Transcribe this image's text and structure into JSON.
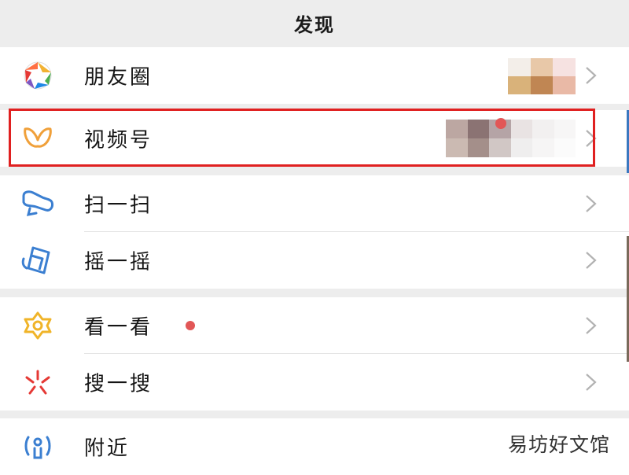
{
  "nav": {
    "title": "发现"
  },
  "menu": {
    "moments": {
      "label": "朋友圈",
      "icon": "moments-aperture-icon"
    },
    "channels": {
      "label": "视频号",
      "icon": "channels-butterfly-icon"
    },
    "scan": {
      "label": "扫一扫",
      "icon": "scan-icon"
    },
    "shake": {
      "label": "摇一摇",
      "icon": "shake-phone-icon"
    },
    "top_stories": {
      "label": "看一看",
      "icon": "top-stories-icon",
      "has_red_dot": true
    },
    "search": {
      "label": "搜一搜",
      "icon": "search-sparkle-icon"
    },
    "nearby": {
      "label": "附近",
      "icon": "nearby-person-icon"
    }
  },
  "colors": {
    "background": "#ededed",
    "row": "#ffffff",
    "highlight": "#e02020",
    "red_dot": "#e25757",
    "chevron": "#b2b2b2"
  },
  "watermark": {
    "text": "易坊好文馆"
  }
}
